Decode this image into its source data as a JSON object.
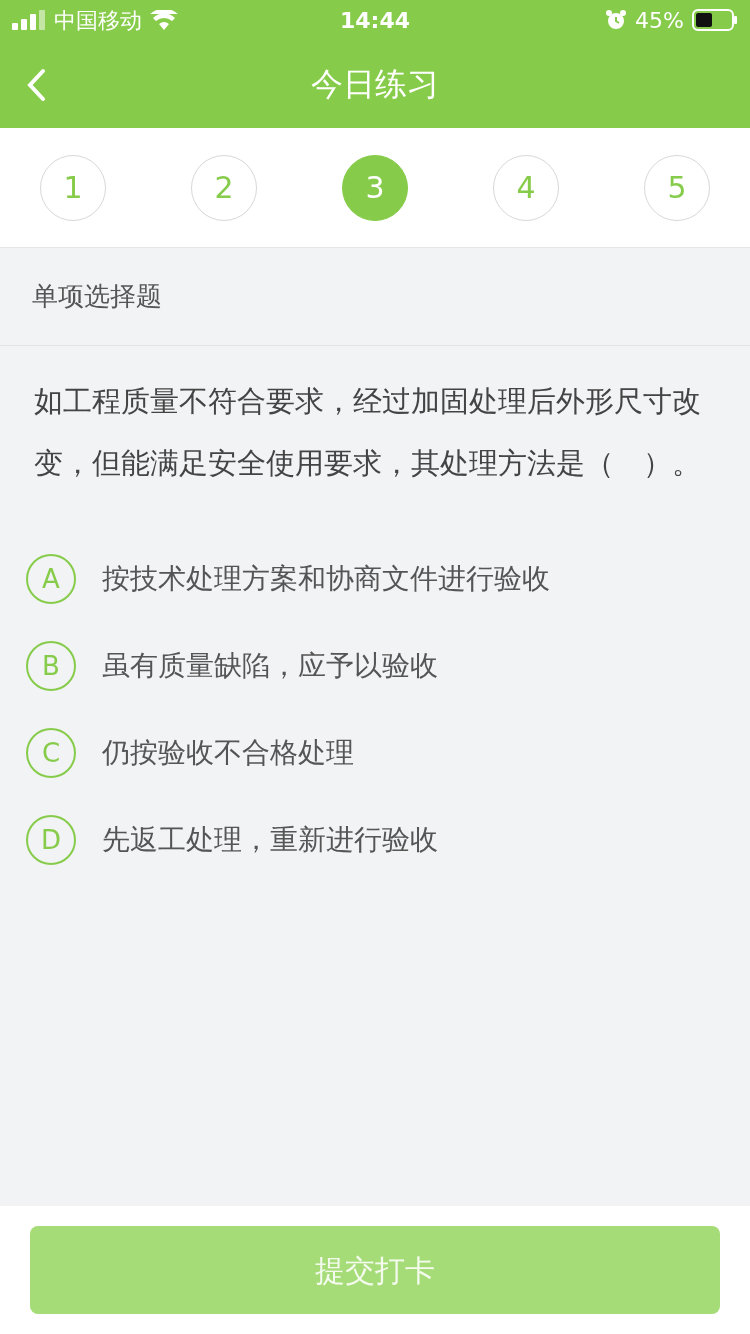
{
  "status_bar": {
    "carrier": "中国移动",
    "time": "14:44",
    "battery": "45%"
  },
  "nav": {
    "title": "今日练习"
  },
  "steps": [
    {
      "label": "1",
      "selected": false
    },
    {
      "label": "2",
      "selected": false
    },
    {
      "label": "3",
      "selected": true
    },
    {
      "label": "4",
      "selected": false
    },
    {
      "label": "5",
      "selected": false
    }
  ],
  "section": "单项选择题",
  "question": "如工程质量不符合要求，经过加固处理后外形尺寸改变，但能满足安全使用要求，其处理方法是（　）。",
  "options": [
    {
      "letter": "A",
      "text": "按技术处理方案和协商文件进行验收",
      "selected": false
    },
    {
      "letter": "B",
      "text": "虽有质量缺陷，应予以验收",
      "selected": false
    },
    {
      "letter": "C",
      "text": "仍按验收不合格处理",
      "selected": false
    },
    {
      "letter": "D",
      "text": "先返工处理，重新进行验收",
      "selected": false
    }
  ],
  "submit": {
    "label": "提交打卡",
    "disabled": true
  }
}
